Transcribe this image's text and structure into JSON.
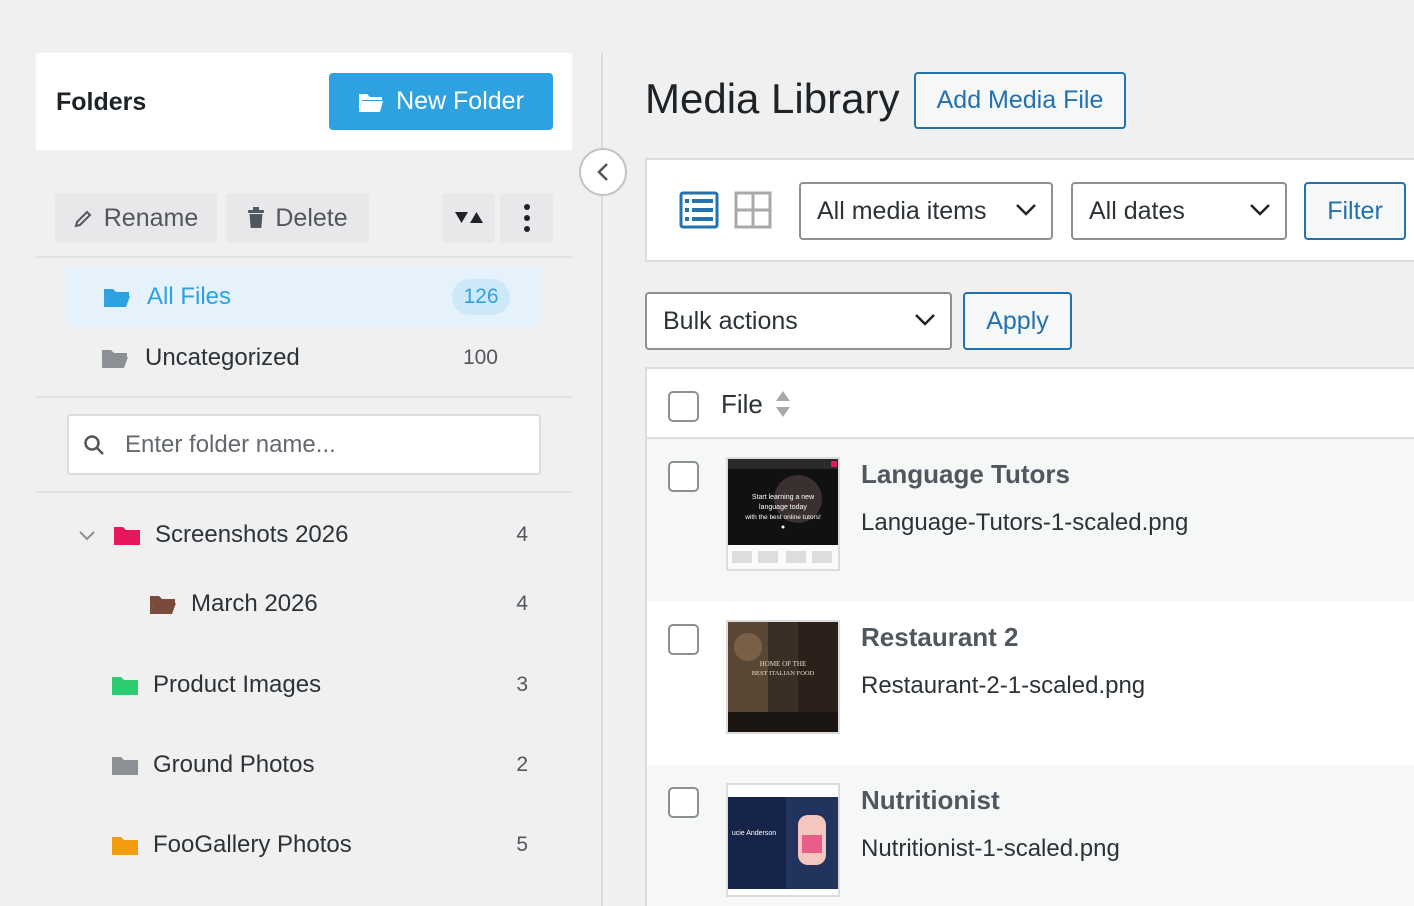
{
  "folders_panel": {
    "title": "Folders",
    "new_folder_label": "New Folder",
    "rename_label": "Rename",
    "delete_label": "Delete",
    "all_files": {
      "label": "All Files",
      "count": "126"
    },
    "uncategorized": {
      "label": "Uncategorized",
      "count": "100"
    },
    "search_placeholder": "Enter folder name...",
    "tree": [
      {
        "label": "Screenshots 2026",
        "count": "4",
        "color": "#e8175d"
      },
      {
        "label": "March 2026",
        "count": "4",
        "color": "#7a4a3a"
      },
      {
        "label": "Product Images",
        "count": "3",
        "color": "#2ecc71"
      },
      {
        "label": "Ground Photos",
        "count": "2",
        "color": "#8c8f94"
      },
      {
        "label": "FooGallery Photos",
        "count": "5",
        "color": "#f39c12"
      }
    ]
  },
  "media_library": {
    "title": "Media Library",
    "add_media_label": "Add Media File",
    "filters": {
      "media_type": "All media items",
      "dates": "All dates",
      "filter_label": "Filter"
    },
    "bulk": {
      "label": "Bulk actions",
      "apply_label": "Apply"
    },
    "table": {
      "file_header": "File",
      "rows": [
        {
          "title": "Language Tutors",
          "filename": "Language-Tutors-1-scaled.png"
        },
        {
          "title": "Restaurant 2",
          "filename": "Restaurant-2-1-scaled.png"
        },
        {
          "title": "Nutritionist",
          "filename": "Nutritionist-1-scaled.png"
        }
      ]
    }
  },
  "thumbs": {
    "t1_line1": "Start learning a new",
    "t1_line2": "language today",
    "t1_line3": "with the best online tutors!",
    "t2_line1": "HOME OF THE",
    "t2_line2": "BEST ITALIAN FOOD",
    "t3_name": "ucie Anderson"
  },
  "colors": {
    "accent": "#2ea2e0",
    "wp_blue": "#2271b1"
  }
}
